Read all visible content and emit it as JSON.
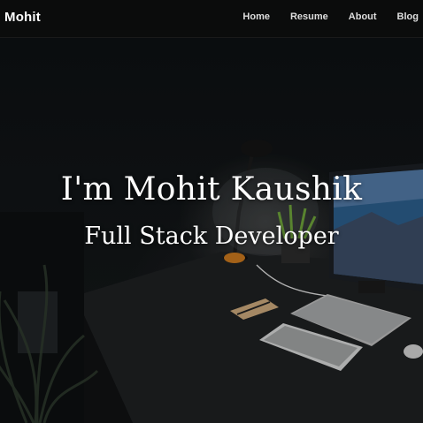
{
  "navbar": {
    "brand": "Mohit",
    "links": [
      {
        "label": "Home"
      },
      {
        "label": "Resume"
      },
      {
        "label": "About"
      },
      {
        "label": "Blog"
      }
    ]
  },
  "hero": {
    "title": "I'm Mohit Kaushik",
    "subtitle": "Full Stack Developer",
    "background": "dark desk workspace photo with monitor, laptop, keyboard, lamp and plant"
  },
  "colors": {
    "navbar_bg": "#0c0c0c",
    "text": "#ffffff",
    "nav_text": "#dedede"
  }
}
